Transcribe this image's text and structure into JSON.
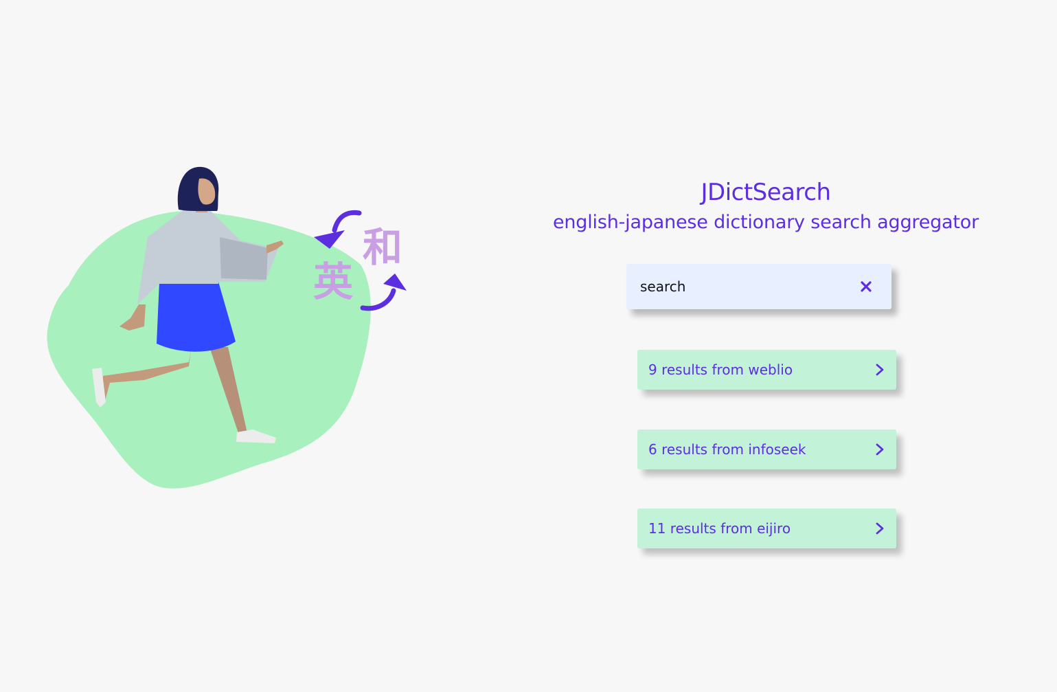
{
  "header": {
    "title": "JDictSearch",
    "subtitle": "english-japanese dictionary search aggregator"
  },
  "search": {
    "value": "search",
    "clear_icon": "close-icon"
  },
  "illustration": {
    "kanji_top": "和",
    "kanji_bottom": "英"
  },
  "results": [
    {
      "label": "9 results from weblio"
    },
    {
      "label": "6 results from infoseek"
    },
    {
      "label": "11 results from eijiro"
    }
  ],
  "colors": {
    "accent": "#5b2ee0",
    "background": "#f7f7f7",
    "search_bg": "#e8efff",
    "result_bg": "#c2f2d8",
    "blob": "#a8f0bd",
    "kanji": "#c89fe3"
  }
}
